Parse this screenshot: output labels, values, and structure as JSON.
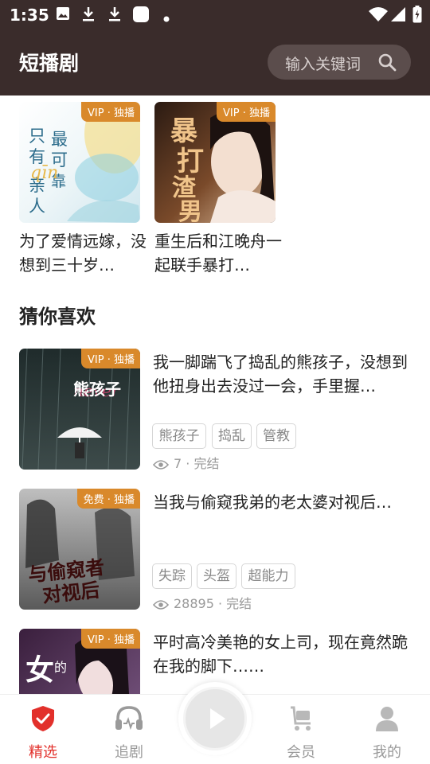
{
  "status_bar": {
    "time": "1:35"
  },
  "header": {
    "title": "短播剧",
    "search_placeholder": "输入关键词"
  },
  "top_row": [
    {
      "title": "为了爱情远嫁，没想到三十岁…",
      "badge": "VIP · 独播",
      "cover_text": "只有最可靠的亲人"
    },
    {
      "title": "重生后和江晚舟一起联手暴打…",
      "badge": "VIP · 独播",
      "cover_text": "暴打渣男"
    }
  ],
  "section": {
    "title": "猜你喜欢"
  },
  "recommend": [
    {
      "title": "我一脚踹飞了捣乱的熊孩子，没想到他扭身出去没过一会，手里握…",
      "badge": "VIP · 独播",
      "tags": [
        "熊孩子",
        "捣乱",
        "管教"
      ],
      "views": "7",
      "status": "完结",
      "cover_text": "熊孩子"
    },
    {
      "title": "当我与偷窥我弟的老太婆对视后…",
      "badge": "免费 · 独播",
      "tags": [
        "失踪",
        "头盔",
        "超能力"
      ],
      "views": "28895",
      "status": "完结",
      "cover_text": "与偷窥者对视后"
    },
    {
      "title": "平时高冷美艳的女上司，现在竟然跪在我的脚下……",
      "badge": "VIP · 独播",
      "tags": [],
      "views": "",
      "status": "",
      "cover_text": "女"
    }
  ],
  "bottom_nav": [
    {
      "label": "精选",
      "icon": "shield-check-icon",
      "active": true
    },
    {
      "label": "追剧",
      "icon": "headphones-icon",
      "active": false
    },
    {
      "label": "",
      "icon": "play-icon",
      "active": false
    },
    {
      "label": "会员",
      "icon": "cart-icon",
      "active": false
    },
    {
      "label": "我的",
      "icon": "person-icon",
      "active": false
    }
  ],
  "colors": {
    "header_bg": "#3a2c2b",
    "badge_bg": "#d9892b",
    "accent": "#e2302b"
  }
}
